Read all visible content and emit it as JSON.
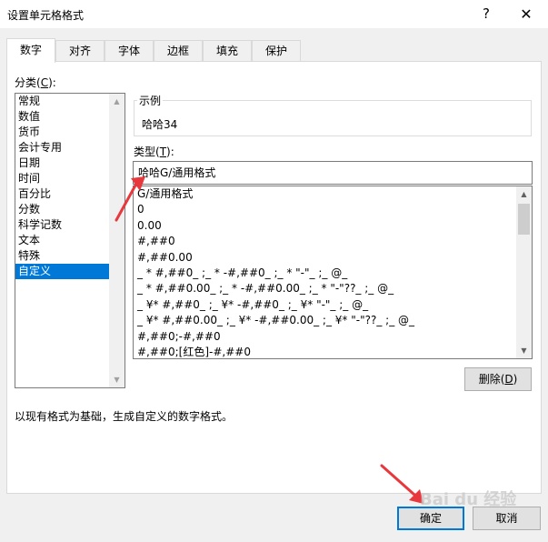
{
  "window": {
    "title": "设置单元格格式",
    "help": "?",
    "close": "✕"
  },
  "tabs": [
    {
      "label": "数字",
      "active": true
    },
    {
      "label": "对齐"
    },
    {
      "label": "字体"
    },
    {
      "label": "边框"
    },
    {
      "label": "填充"
    },
    {
      "label": "保护"
    }
  ],
  "category": {
    "label_prefix": "分类(",
    "label_key": "C",
    "label_suffix": "):",
    "items": [
      "常规",
      "数值",
      "货币",
      "会计专用",
      "日期",
      "时间",
      "百分比",
      "分数",
      "科学记数",
      "文本",
      "特殊",
      "自定义"
    ],
    "selected": "自定义"
  },
  "sample": {
    "legend": "示例",
    "value": "哈哈34"
  },
  "type": {
    "label_prefix": "类型(",
    "label_key": "T",
    "label_suffix": "):",
    "value": "哈哈G/通用格式"
  },
  "formats": [
    "G/通用格式",
    "0",
    "0.00",
    "#,##0",
    "#,##0.00",
    "_ * #,##0_ ;_ * -#,##0_ ;_ * \"-\"_ ;_ @_",
    "_ * #,##0.00_ ;_ * -#,##0.00_ ;_ * \"-\"??_ ;_ @_",
    "_ ¥* #,##0_ ;_ ¥* -#,##0_ ;_ ¥* \"-\"_ ;_ @_",
    "_ ¥* #,##0.00_ ;_ ¥* -#,##0.00_ ;_ ¥* \"-\"??_ ;_ @_",
    "#,##0;-#,##0",
    "#,##0;[红色]-#,##0"
  ],
  "delete_btn": {
    "text": "删除(",
    "key": "D",
    "suffix": ")"
  },
  "description": "以现有格式为基础，生成自定义的数字格式。",
  "buttons": {
    "ok": "确定",
    "cancel": "取消"
  },
  "watermark": "Bai du 经验",
  "colors": {
    "accent": "#0078d7",
    "annotation": "#e8383d"
  }
}
